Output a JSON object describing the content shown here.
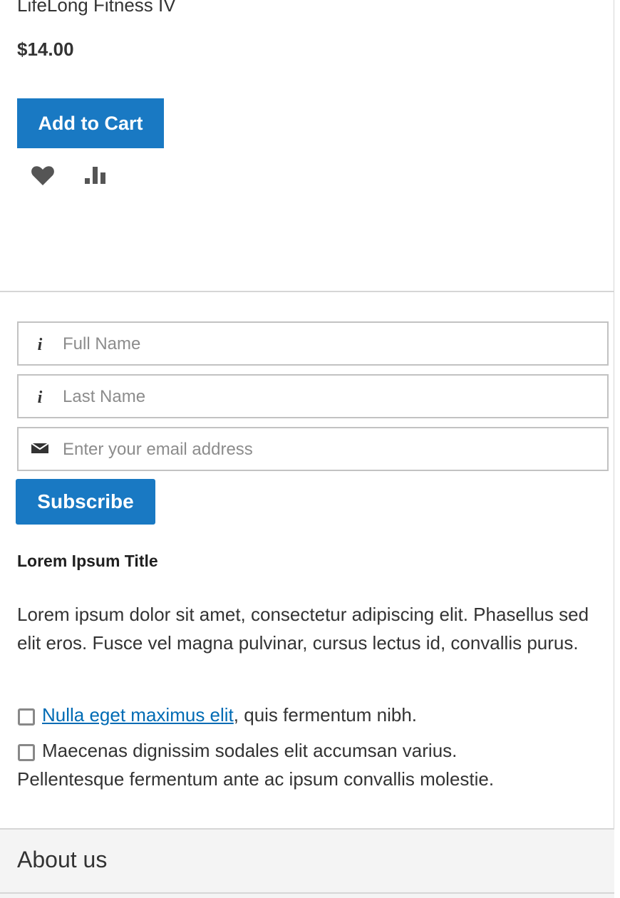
{
  "product": {
    "name": "LifeLong Fitness IV",
    "price": "$14.00",
    "add_to_cart_label": "Add to Cart",
    "wishlist_icon": "heart-icon",
    "compare_icon": "bar-chart-icon"
  },
  "newsletter": {
    "full_name_placeholder": "Full Name",
    "last_name_placeholder": "Last Name",
    "email_placeholder": "Enter your email address",
    "subscribe_label": "Subscribe"
  },
  "content": {
    "title": "Lorem Ipsum Title",
    "paragraph": "Lorem ipsum dolor sit amet, consectetur adipiscing elit. Phasellus sed elit eros. Fusce vel magna pulvinar, cursus lectus id, convallis purus.",
    "checkbox1_link": "Nulla eget maximus elit",
    "checkbox1_rest": ", quis fermentum nibh.",
    "checkbox2_line1": "Maecenas dignissim sodales elit accumsan varius.",
    "checkbox2_line2": "Pellentesque fermentum ante ac ipsum convallis molestie."
  },
  "footer": {
    "about_label": "About us"
  },
  "colors": {
    "primary_button": "#1979c3",
    "link": "#006bb4"
  }
}
